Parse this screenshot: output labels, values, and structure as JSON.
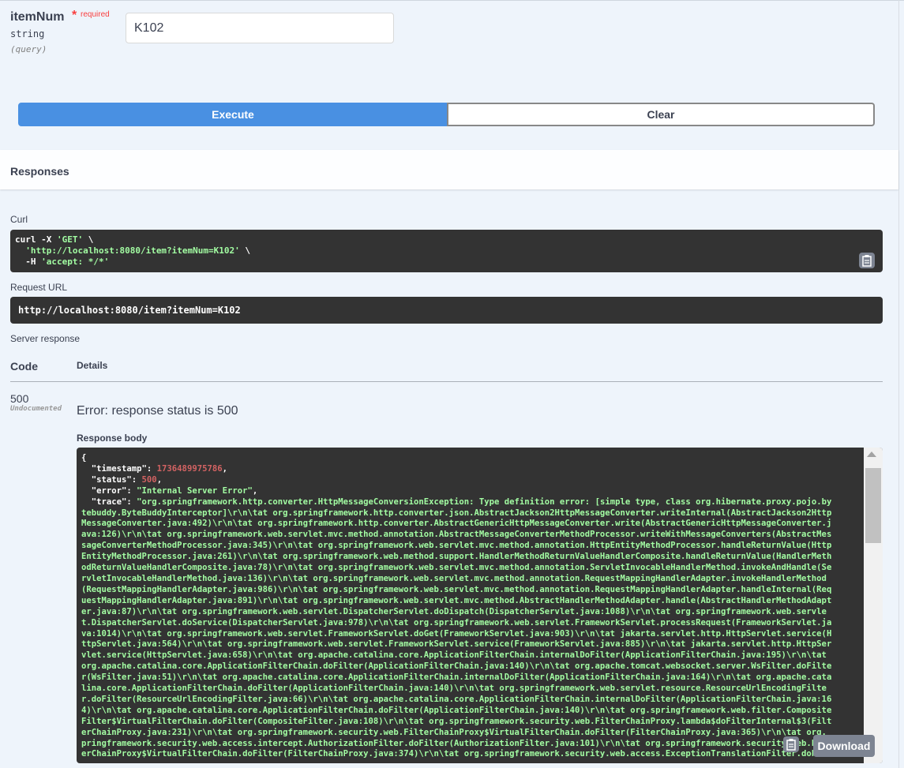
{
  "parameter": {
    "name": "itemNum",
    "required_star": "*",
    "required_label": "required",
    "type": "string",
    "in": "(query)",
    "value": "K102"
  },
  "buttons": {
    "execute": "Execute",
    "clear": "Clear"
  },
  "responses": {
    "title": "Responses",
    "curl_label": "Curl",
    "curl_line1_cmd": "curl -X ",
    "curl_line1_method": "'GET'",
    "curl_line1_end": " \\",
    "curl_line2_url": "'http://localhost:8080/item?itemNum=K102'",
    "curl_line2_end": " \\",
    "curl_line3_flag": "  -H ",
    "curl_line3_header": "'accept: */*'",
    "request_url_label": "Request URL",
    "request_url": "http://localhost:8080/item?itemNum=K102",
    "server_response_label": "Server response",
    "code_header": "Code",
    "details_header": "Details",
    "status_code": "500",
    "undocumented": "Undocumented",
    "error_message": "Error: response status is 500",
    "response_body_label": "Response body",
    "download_label": "Download"
  },
  "response_body": {
    "open_brace": "{",
    "timestamp_key": "  \"timestamp\": ",
    "timestamp_value": "1736489975786",
    "status_key": "  \"status\": ",
    "status_value": "500",
    "error_key": "  \"error\": ",
    "error_value": "\"Internal Server Error\"",
    "trace_key": "  \"trace\": ",
    "trace_lines": [
      "\"org.springframework.http.converter.HttpMessageConversionException: Type definition error: [simple type, class org.hibernate.proxy.pojo.by",
      "tebuddy.ByteBuddyInterceptor]\\r\\n\\tat org.springframework.http.converter.json.AbstractJackson2HttpMessageConverter.writeInternal(AbstractJackson2Http",
      "MessageConverter.java:492)\\r\\n\\tat org.springframework.http.converter.AbstractGenericHttpMessageConverter.write(AbstractGenericHttpMessageConverter.j",
      "ava:126)\\r\\n\\tat org.springframework.web.servlet.mvc.method.annotation.AbstractMessageConverterMethodProcessor.writeWithMessageConverters(AbstractMes",
      "sageConverterMethodProcessor.java:345)\\r\\n\\tat org.springframework.web.servlet.mvc.method.annotation.HttpEntityMethodProcessor.handleReturnValue(Http",
      "EntityMethodProcessor.java:261)\\r\\n\\tat org.springframework.web.method.support.HandlerMethodReturnValueHandlerComposite.handleReturnValue(HandlerMeth",
      "odReturnValueHandlerComposite.java:78)\\r\\n\\tat org.springframework.web.servlet.mvc.method.annotation.ServletInvocableHandlerMethod.invokeAndHandle(Se",
      "rvletInvocableHandlerMethod.java:136)\\r\\n\\tat org.springframework.web.servlet.mvc.method.annotation.RequestMappingHandlerAdapter.invokeHandlerMethod",
      "(RequestMappingHandlerAdapter.java:986)\\r\\n\\tat org.springframework.web.servlet.mvc.method.annotation.RequestMappingHandlerAdapter.handleInternal(Req",
      "uestMappingHandlerAdapter.java:891)\\r\\n\\tat org.springframework.web.servlet.mvc.method.AbstractHandlerMethodAdapter.handle(AbstractHandlerMethodAdapt",
      "er.java:87)\\r\\n\\tat org.springframework.web.servlet.DispatcherServlet.doDispatch(DispatcherServlet.java:1088)\\r\\n\\tat org.springframework.web.servle",
      "t.DispatcherServlet.doService(DispatcherServlet.java:978)\\r\\n\\tat org.springframework.web.servlet.FrameworkServlet.processRequest(FrameworkServlet.ja",
      "va:1014)\\r\\n\\tat org.springframework.web.servlet.FrameworkServlet.doGet(FrameworkServlet.java:903)\\r\\n\\tat jakarta.servlet.http.HttpServlet.service(H",
      "ttpServlet.java:564)\\r\\n\\tat org.springframework.web.servlet.FrameworkServlet.service(FrameworkServlet.java:885)\\r\\n\\tat jakarta.servlet.http.HttpSer",
      "vlet.service(HttpServlet.java:658)\\r\\n\\tat org.apache.catalina.core.ApplicationFilterChain.internalDoFilter(ApplicationFilterChain.java:195)\\r\\n\\tat",
      "org.apache.catalina.core.ApplicationFilterChain.doFilter(ApplicationFilterChain.java:140)\\r\\n\\tat org.apache.tomcat.websocket.server.WsFilter.doFilte",
      "r(WsFilter.java:51)\\r\\n\\tat org.apache.catalina.core.ApplicationFilterChain.internalDoFilter(ApplicationFilterChain.java:164)\\r\\n\\tat org.apache.cata",
      "lina.core.ApplicationFilterChain.doFilter(ApplicationFilterChain.java:140)\\r\\n\\tat org.springframework.web.servlet.resource.ResourceUrlEncodingFilte",
      "r.doFilter(ResourceUrlEncodingFilter.java:66)\\r\\n\\tat org.apache.catalina.core.ApplicationFilterChain.internalDoFilter(ApplicationFilterChain.java:16",
      "4)\\r\\n\\tat org.apache.catalina.core.ApplicationFilterChain.doFilter(ApplicationFilterChain.java:140)\\r\\n\\tat org.springframework.web.filter.Composite",
      "Filter$VirtualFilterChain.doFilter(CompositeFilter.java:108)\\r\\n\\tat org.springframework.security.web.FilterChainProxy.lambda$doFilterInternal$3(Filt",
      "erChainProxy.java:231)\\r\\n\\tat org.springframework.security.web.FilterChainProxy$VirtualFilterChain.doFilter(FilterChainProxy.java:365)\\r\\n\\tat org.",
      "pringframework.security.web.access.intercept.AuthorizationFilter.doFilter(AuthorizationFilter.java:101)\\r\\n\\tat org.springframework.security.web.Filt",
      "erChainProxy$VirtualFilterChain.doFilter(FilterChainProxy.java:374)\\r\\n\\tat org.springframework.security.web.access.ExceptionTranslationFilter.doFilt"
    ]
  }
}
